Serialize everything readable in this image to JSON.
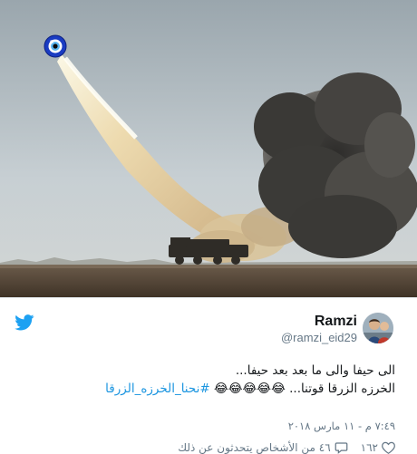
{
  "photo": {
    "evil_eye_icon": "evil-eye-icon",
    "colors": {
      "sky": "#b8c2c9",
      "smoke_dark": "#3d3c3a",
      "plume": "#e0cba0",
      "ground": "#5a4a3b",
      "eye_blue": "#1a3cc2"
    }
  },
  "tweet": {
    "author_name": "Ramzi",
    "author_handle": "@ramzi_eid29",
    "line1": "الى حيفا والى ما بعد بعد حيفا...",
    "line2_text": "الخرزه الزرقا قوتنا...",
    "line2_emoji": "😂😂😂😂😂",
    "hashtag": "#نحنا_الخرزه_الزرقا",
    "timestamp": "٧:٤٩ م - ١١ مارس ٢٠١٨",
    "likes_count": "١٦٢",
    "people_talking": "٤٦ من الأشخاص يتحدثون عن ذلك",
    "twitter_icon": "twitter-bird-icon",
    "heart_icon": "heart-icon",
    "comment_icon": "comment-icon",
    "brand_color": "#1da1f2"
  }
}
